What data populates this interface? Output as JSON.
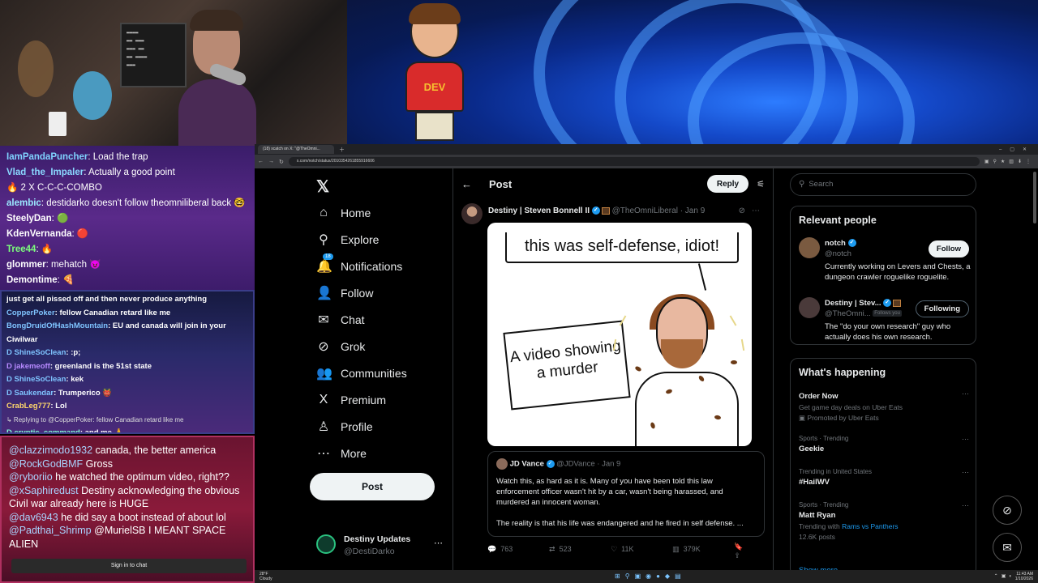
{
  "chat_top": [
    {
      "user": "IamPandaPuncher",
      "color": "#7fd3ff",
      "text": "Load the trap"
    },
    {
      "user": "Vlad_the_Impaler",
      "color": "#8ad8ff",
      "text": "Actually a good point"
    },
    {
      "user": "",
      "color": "#fff",
      "text": "🔥 2 X C-C-C-COMBO"
    },
    {
      "user": "alembic",
      "color": "#9be8ff",
      "text": "destidarko doesn't follow theomniliberal back 🤓"
    },
    {
      "user": "SteelyDan",
      "color": "#ffffff",
      "text": "🟢"
    },
    {
      "user": "KdenVernanda",
      "color": "#ffffff",
      "text": "🔴"
    },
    {
      "user": "Tree44",
      "color": "#7cff7c",
      "text": "🔥"
    },
    {
      "user": "glommer",
      "color": "#ffffff",
      "text": "mehatch 😈"
    },
    {
      "user": "Demontime",
      "color": "#ffffff",
      "text": "🍕"
    }
  ],
  "chat_mid": [
    {
      "user": "",
      "color": "#ffffff",
      "text": "just get all pissed off and then never produce anything"
    },
    {
      "user": "CopperPoker",
      "color": "#7fc4ff",
      "text": "fellow Canadian retard like me"
    },
    {
      "user": "BongDruidOfHashMountain",
      "color": "#7fc4ff",
      "text": "EU and canada will join in your"
    },
    {
      "user": "",
      "color": "#ffffff",
      "text": "Ciwilwar"
    },
    {
      "user": "D ShineSoClean",
      "color": "#7fc4ff",
      "text": ":p;"
    },
    {
      "user": "D jakemeoff",
      "color": "#b68aff",
      "text": "greenland is the 51st state"
    },
    {
      "user": "D ShineSoClean",
      "color": "#7fc4ff",
      "text": "kek"
    },
    {
      "user": "D Saukendar",
      "color": "#7fc4ff",
      "text": "Trumperico 👹"
    },
    {
      "user": "CrabLeg777",
      "color": "#ffd86b",
      "text": "Lol"
    },
    {
      "user": "",
      "color": "#dddddd",
      "text": "↳ Replying to @CopperPoker: fellow Canadian retard like me"
    },
    {
      "user": "D cryptic_command",
      "color": "#7fffd4",
      "text": "and me 🙏"
    }
  ],
  "chat_bottom": [
    {
      "user": "@clazzimodo1932",
      "text": "canada, the better america"
    },
    {
      "user": "@RockGodBMF",
      "text": "Gross"
    },
    {
      "user": "@ryboriio",
      "text": "he watched the optimum video, right??"
    },
    {
      "user": "@xSaphiredust",
      "text": "Destiny acknowledging the obvious Civil war already here is HUGE"
    },
    {
      "user": "@dav6943",
      "text": "he did say a boot instead of about lol"
    },
    {
      "user": "@Padthai_Shrimp",
      "text": "@MurielSB I MEANT SPACE ALIEN"
    }
  ],
  "chat_signin": "Sign in to chat",
  "mascot_shirt": "DEV",
  "browser": {
    "tab_title": "(18) xcatch on X: \"@TheOmni...",
    "url": "x.com/notch/status/2010354261855916606"
  },
  "nav": {
    "items": [
      {
        "icon": "⌂",
        "label": "Home",
        "name": "nav-home"
      },
      {
        "icon": "⚲",
        "label": "Explore",
        "name": "nav-explore"
      },
      {
        "icon": "🔔",
        "label": "Notifications",
        "name": "nav-notifications",
        "badge": "18"
      },
      {
        "icon": "👤",
        "label": "Follow",
        "name": "nav-follow"
      },
      {
        "icon": "✉",
        "label": "Chat",
        "name": "nav-chat"
      },
      {
        "icon": "⊘",
        "label": "Grok",
        "name": "nav-grok"
      },
      {
        "icon": "👥",
        "label": "Communities",
        "name": "nav-communities"
      },
      {
        "icon": "X",
        "label": "Premium",
        "name": "nav-premium"
      },
      {
        "icon": "♙",
        "label": "Profile",
        "name": "nav-profile"
      },
      {
        "icon": "⋯",
        "label": "More",
        "name": "nav-more"
      }
    ],
    "post_label": "Post",
    "account_name": "Destiny Updates",
    "account_handle": "@DestiDarko"
  },
  "post": {
    "header_title": "Post",
    "reply_label": "Reply",
    "author_name": "Destiny | Steven Bonnell II",
    "author_handle": "@TheOmniLiberal · Jan 9",
    "meme_bubble": "this was self-defense, idiot!",
    "meme_sign": "A video showing a murder",
    "quote_author": "JD Vance",
    "quote_handle": "@JDVance · Jan 9",
    "quote_text_1": "Watch this, as hard as it is. Many of you have been told this law enforcement officer wasn't hit by a car, wasn't being harassed, and murdered an innocent woman.",
    "quote_text_2": "The reality is that his life was endangered and he fired in self defense. ...",
    "stats": {
      "replies": "763",
      "reposts": "523",
      "likes": "11K",
      "views": "379K"
    }
  },
  "sidebar": {
    "search_placeholder": "Search",
    "relevant_title": "Relevant people",
    "people": [
      {
        "name": "notch",
        "handle": "@notch",
        "bio": "Currently working on Levers and Chests, a dungeon crawler roguelike roguelite.",
        "button": "Follow"
      },
      {
        "name": "Destiny | Stev...",
        "handle": "@TheOmni...",
        "follows_you": "Follows you",
        "bio": "The \"do your own research\" guy who actually does his own research.",
        "button": "Following"
      }
    ],
    "happening_title": "What's happening",
    "trends": [
      {
        "context": "",
        "title": "Order Now",
        "sub": "Get game day deals on Uber Eats",
        "sub2": "Promoted by Uber Eats"
      },
      {
        "context": "Sports · Trending",
        "title": "Geekie",
        "sub": "",
        "sub2": ""
      },
      {
        "context": "Trending in United States",
        "title": "#HailWV",
        "sub": "",
        "sub2": ""
      },
      {
        "context": "Sports · Trending",
        "title": "Matt Ryan",
        "sub": "Trending with",
        "link": "Rams vs Panthers",
        "sub2": "12.6K posts"
      }
    ],
    "show_more": "Show more"
  },
  "taskbar": {
    "temp": "28°F",
    "weather": "Cloudy",
    "time": "11:43 AM",
    "date": "1/10/2026"
  }
}
